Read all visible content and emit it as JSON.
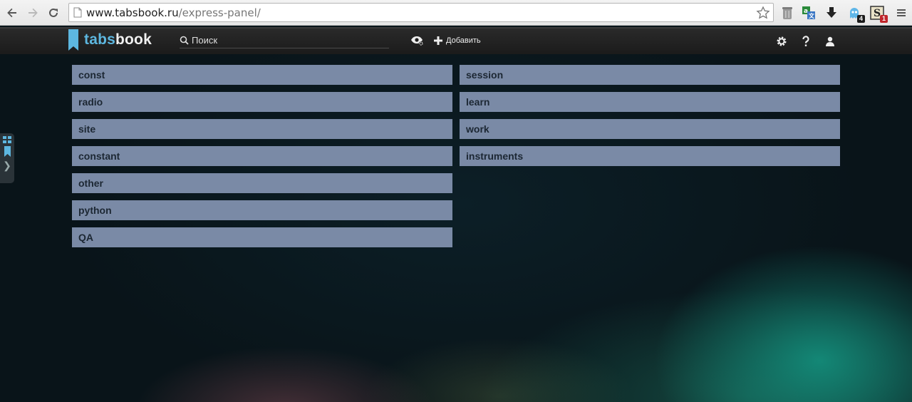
{
  "browser": {
    "url_host": "www.tabsbook.ru",
    "url_path": "/express-panel/",
    "extensions": [
      {
        "name": "trash-extension-icon"
      },
      {
        "name": "translate-extension-icon"
      },
      {
        "name": "download-extension-icon"
      },
      {
        "name": "ghost-extension-icon",
        "badge": "4",
        "badge_color": "#1a1a1a"
      },
      {
        "name": "s-extension-icon",
        "badge": "1",
        "badge_color": "#c0262b"
      }
    ]
  },
  "app": {
    "brand_first": "tabs",
    "brand_second": "book",
    "search_placeholder": "Поиск",
    "add_label": "Добавить",
    "accent": "#5db7e0"
  },
  "folders_left": [
    "const",
    "radio",
    "site",
    "constant",
    "other",
    "python",
    "QA"
  ],
  "folders_right": [
    "session",
    "learn",
    "work",
    "instruments"
  ],
  "side_arrow": "❯"
}
